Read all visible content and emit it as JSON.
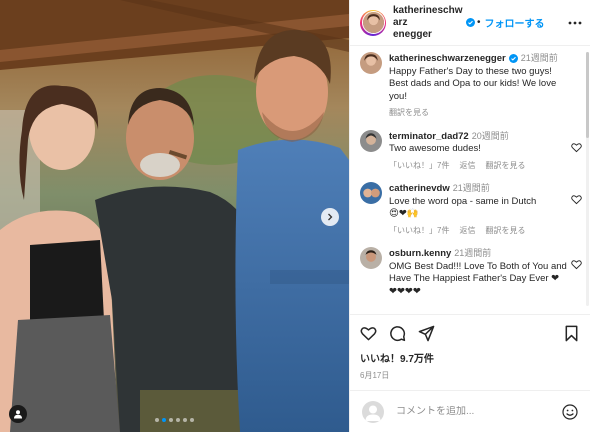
{
  "post": {
    "username": "katherineschwarzenegger",
    "username_line1": "katherineschwarz",
    "username_line2": "enegger",
    "separator": "•",
    "follow_label": "フォローする",
    "caption": {
      "username": "katherineschwarzenegger",
      "time": "21週間前",
      "text": "Happy Father's Day to these two guys! Best dads and Opa to our kids! We love you!",
      "translate_label": "翻訳を見る"
    },
    "likes": "いいね！9.7万件",
    "date": "6月17日",
    "carousel": {
      "slides": 6,
      "active": 1
    }
  },
  "comments": [
    {
      "username": "terminator_dad72",
      "time": "20週間前",
      "text": "Two awesome dudes!",
      "likes_label": "「いいね！」7件",
      "reply_label": "返信",
      "translate_label": "翻訳を見る"
    },
    {
      "username": "catherinevdw",
      "time": "21週間前",
      "text": "Love the word opa - same in Dutch",
      "emoji": "😍❤🙌",
      "likes_label": "「いいね！」7件",
      "reply_label": "返信",
      "translate_label": "翻訳を見る"
    },
    {
      "username": "osburn.kenny",
      "time": "21週間前",
      "text": "OMG Best Dad!!! Love To Both of You and Have The Happiest Father's Day Ever ❤❤❤❤❤"
    }
  ],
  "comment_box": {
    "placeholder": "コメントを追加..."
  },
  "colors": {
    "accent": "#0095f6",
    "text": "#262626",
    "muted": "#8e8e8e",
    "border": "#efefef"
  },
  "icons": [
    "verified-icon",
    "more-icon",
    "heart-icon",
    "comment-icon",
    "share-icon",
    "bookmark-icon",
    "emoji-icon",
    "next-arrow-icon",
    "user-tag-icon"
  ]
}
